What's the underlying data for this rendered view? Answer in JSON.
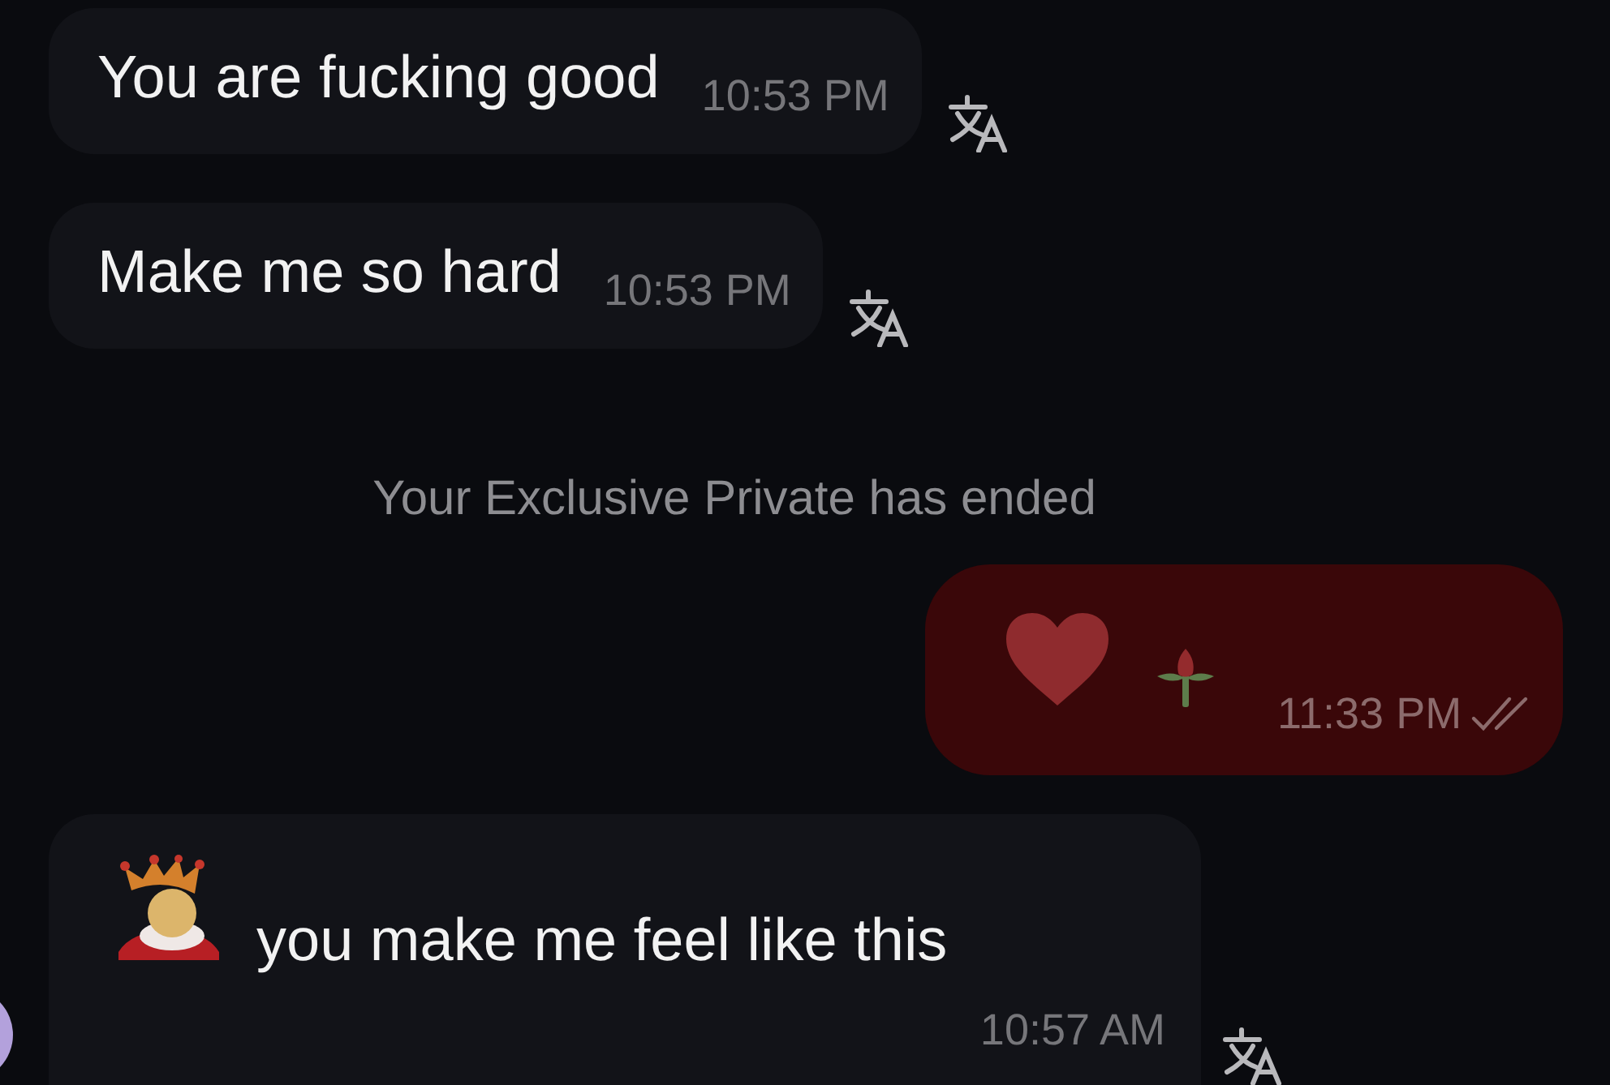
{
  "chat": {
    "messages": [
      {
        "kind": "text",
        "outgoing": false,
        "avatar": false,
        "text": "You are fucking good",
        "time": "10:53 PM",
        "translate": true
      },
      {
        "kind": "text",
        "outgoing": false,
        "avatar": false,
        "text": "Make me so hard",
        "time": "10:53 PM",
        "translate": true
      },
      {
        "kind": "system",
        "text": "Your Exclusive Private has ended"
      },
      {
        "kind": "emoji",
        "outgoing": true,
        "time": "11:33 PM",
        "read": true
      },
      {
        "kind": "emoji_text",
        "outgoing": false,
        "avatar": true,
        "text": "you make me feel like this",
        "time": "10:57 AM",
        "translate": true
      }
    ]
  }
}
